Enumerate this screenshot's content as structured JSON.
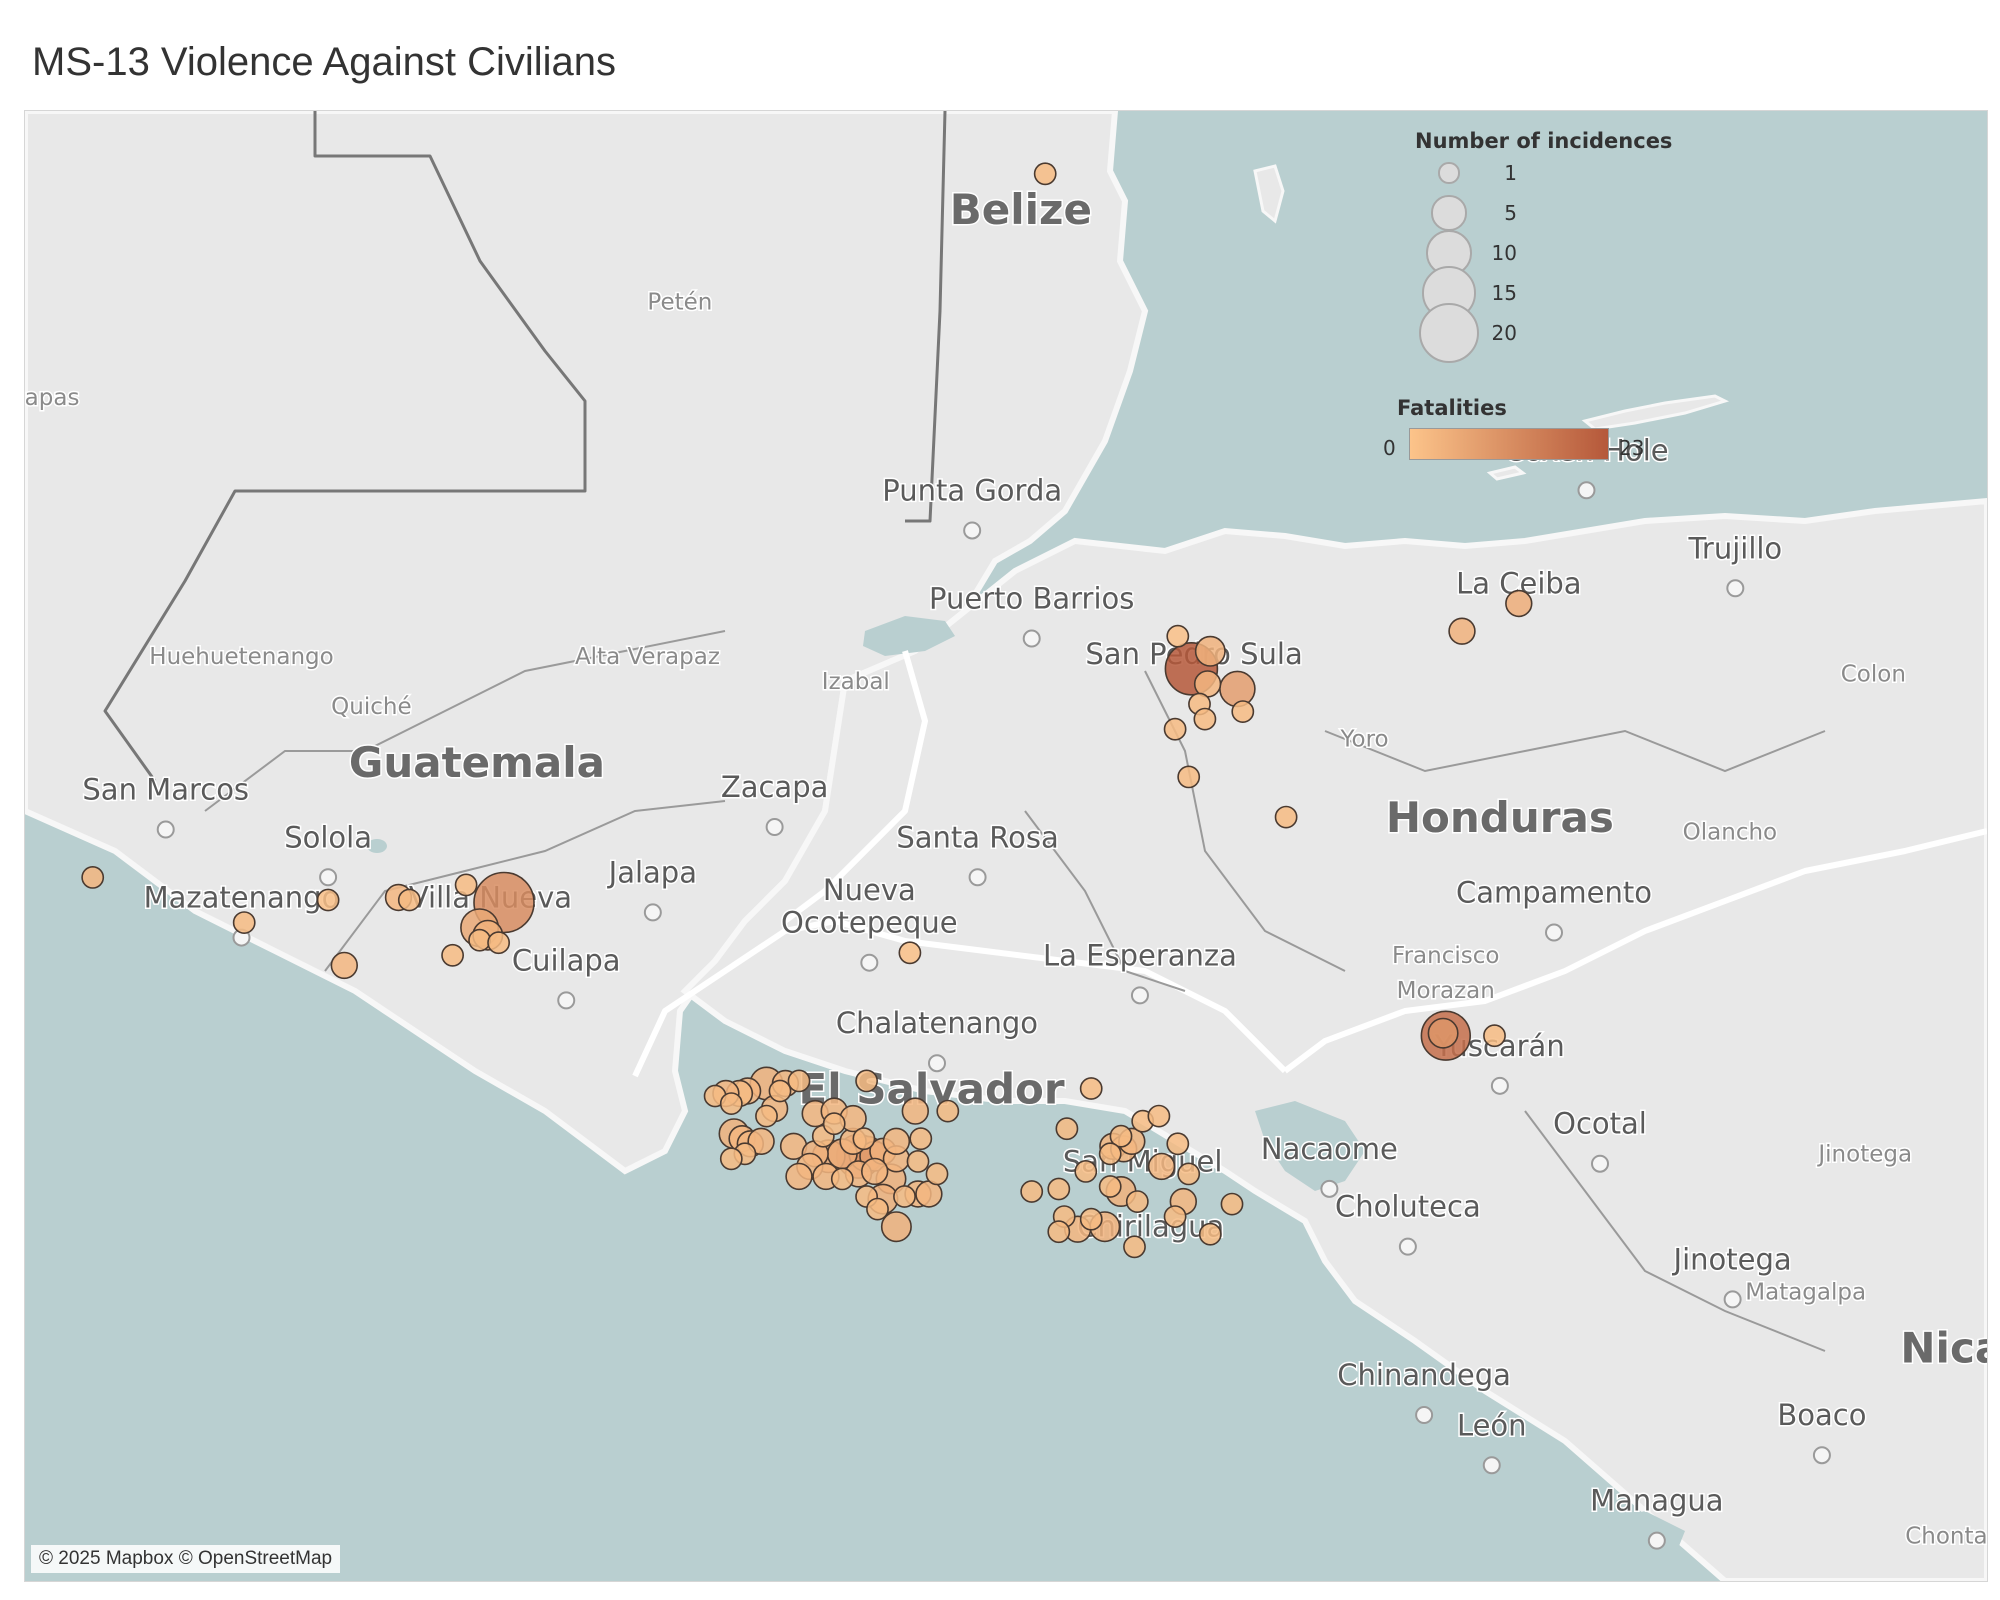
{
  "title": "MS-13 Violence Against Civilians",
  "attribution": "© 2025 Mapbox © OpenStreetMap",
  "colors": {
    "water": "#b9cfd0",
    "land": "#e8e8e8",
    "border": "#ffffff",
    "fatalities_min": "#fcc48a",
    "fatalities_max": "#b5583a"
  },
  "legend": {
    "size_title": "Number of incidences",
    "size_items": [
      {
        "label": "1",
        "value": 1
      },
      {
        "label": "5",
        "value": 5
      },
      {
        "label": "10",
        "value": 10
      },
      {
        "label": "15",
        "value": 15
      },
      {
        "label": "20",
        "value": 20
      }
    ],
    "color_title": "Fatalities",
    "color_min": "0",
    "color_max": "23"
  },
  "map": {
    "country_labels": [
      {
        "text": "Belize",
        "lon": -88.62,
        "lat": 17.25
      },
      {
        "text": "Guatemala",
        "lon": -90.63,
        "lat": 15.05
      },
      {
        "text": "Honduras",
        "lon": -86.85,
        "lat": 14.83
      },
      {
        "text": "El Salvador",
        "lon": -88.95,
        "lat": 13.75
      },
      {
        "text": "Nica",
        "lon": -85.18,
        "lat": 12.72
      }
    ],
    "city_labels": [
      {
        "text": "Punta Gorda",
        "lon": -88.8,
        "lat": 16.15,
        "dot": true
      },
      {
        "text": "Puerto Barrios",
        "lon": -88.58,
        "lat": 15.72,
        "dot": true
      },
      {
        "text": "San Pedro Sula",
        "lon": -87.98,
        "lat": 15.5,
        "dot": false
      },
      {
        "text": "La Ceiba",
        "lon": -86.78,
        "lat": 15.78,
        "dot": false
      },
      {
        "text": "Trujillo",
        "lon": -85.98,
        "lat": 15.92,
        "dot": true
      },
      {
        "text": "Coxen Hole",
        "lon": -86.53,
        "lat": 16.31,
        "dot": true
      },
      {
        "text": "San Marcos",
        "lon": -91.78,
        "lat": 14.96,
        "dot": true
      },
      {
        "text": "Solola",
        "lon": -91.18,
        "lat": 14.77,
        "dot": true
      },
      {
        "text": "Mazatenango",
        "lon": -91.5,
        "lat": 14.53,
        "dot": true
      },
      {
        "text": "Villa Nueva",
        "lon": -90.58,
        "lat": 14.53,
        "dot": false
      },
      {
        "text": "Cuilapa",
        "lon": -90.3,
        "lat": 14.28,
        "dot": true
      },
      {
        "text": "Jalapa",
        "lon": -89.98,
        "lat": 14.63,
        "dot": true
      },
      {
        "text": "Zacapa",
        "lon": -89.53,
        "lat": 14.97,
        "dot": true
      },
      {
        "text": "Santa Rosa",
        "lon": -88.78,
        "lat": 14.77,
        "dot": true
      },
      {
        "text": "Nueva",
        "lon": -89.18,
        "lat": 14.56,
        "dot": false
      },
      {
        "text": "Ocotepeque",
        "lon": -89.18,
        "lat": 14.43,
        "dot": true
      },
      {
        "text": "La Esperanza",
        "lon": -88.18,
        "lat": 14.3,
        "dot": true
      },
      {
        "text": "Chalatenango",
        "lon": -88.93,
        "lat": 14.03,
        "dot": true
      },
      {
        "text": "San Miguel",
        "lon": -88.17,
        "lat": 13.48,
        "dot": false
      },
      {
        "text": "Chirilagua",
        "lon": -88.14,
        "lat": 13.22,
        "dot": false
      },
      {
        "text": "Nacaome",
        "lon": -87.48,
        "lat": 13.53,
        "dot": true
      },
      {
        "text": "Choluteca",
        "lon": -87.19,
        "lat": 13.3,
        "dot": true
      },
      {
        "text": "Yuscarán",
        "lon": -86.85,
        "lat": 13.94,
        "dot": true
      },
      {
        "text": "Ocotal",
        "lon": -86.48,
        "lat": 13.63,
        "dot": true
      },
      {
        "text": "Jinotega",
        "lon": -85.99,
        "lat": 13.09,
        "dot": true
      },
      {
        "text": "Chinandega",
        "lon": -87.13,
        "lat": 12.63,
        "dot": true
      },
      {
        "text": "León",
        "lon": -86.88,
        "lat": 12.43,
        "dot": true
      },
      {
        "text": "Boaco",
        "lon": -85.66,
        "lat": 12.47,
        "dot": true
      },
      {
        "text": "Managua",
        "lon": -86.27,
        "lat": 12.13,
        "dot": true
      },
      {
        "text": "Campamento",
        "lon": -86.65,
        "lat": 14.55,
        "dot": true
      }
    ],
    "region_labels": [
      {
        "text": "Petén",
        "lon": -89.88,
        "lat": 16.91
      },
      {
        "text": "apas",
        "lon": -92.2,
        "lat": 16.53
      },
      {
        "text": "Huehuetenango",
        "lon": -91.5,
        "lat": 15.5
      },
      {
        "text": "Quiché",
        "lon": -91.02,
        "lat": 15.3
      },
      {
        "text": "Alta Verapaz",
        "lon": -90.0,
        "lat": 15.5
      },
      {
        "text": "Izabal",
        "lon": -89.23,
        "lat": 15.4
      },
      {
        "text": "Yoro",
        "lon": -87.35,
        "lat": 15.17
      },
      {
        "text": "Colon",
        "lon": -85.47,
        "lat": 15.43
      },
      {
        "text": "Olancho",
        "lon": -86.0,
        "lat": 14.8
      },
      {
        "text": "Francisco",
        "lon": -87.05,
        "lat": 14.31
      },
      {
        "text": "Morazan",
        "lon": -87.05,
        "lat": 14.17
      },
      {
        "text": "Jinotega",
        "lon": -85.5,
        "lat": 13.52
      },
      {
        "text": "Matagalpa",
        "lon": -85.72,
        "lat": 12.97
      },
      {
        "text": "Chonta",
        "lon": -85.2,
        "lat": 12.0
      }
    ]
  },
  "chart_data": {
    "type": "scatter",
    "title": "MS-13 Violence Against Civilians",
    "size_field": "Number of incidences",
    "color_field": "Fatalities",
    "color_range": [
      0,
      23
    ],
    "size_range": [
      1,
      20
    ],
    "points": [
      {
        "lon": -88.53,
        "lat": 17.45,
        "incidences": 1,
        "fatalities": 2
      },
      {
        "lon": -92.05,
        "lat": 14.65,
        "incidences": 1,
        "fatalities": 3
      },
      {
        "lon": -90.53,
        "lat": 14.55,
        "incidences": 20,
        "fatalities": 12
      },
      {
        "lon": -90.62,
        "lat": 14.45,
        "incidences": 6,
        "fatalities": 6
      },
      {
        "lon": -90.59,
        "lat": 14.42,
        "incidences": 3,
        "fatalities": 4
      },
      {
        "lon": -90.67,
        "lat": 14.62,
        "incidences": 1,
        "fatalities": 2
      },
      {
        "lon": -90.92,
        "lat": 14.57,
        "incidences": 2,
        "fatalities": 3
      },
      {
        "lon": -90.88,
        "lat": 14.56,
        "incidences": 1,
        "fatalities": 2
      },
      {
        "lon": -90.62,
        "lat": 14.4,
        "incidences": 1,
        "fatalities": 2
      },
      {
        "lon": -90.55,
        "lat": 14.39,
        "incidences": 1,
        "fatalities": 2
      },
      {
        "lon": -90.72,
        "lat": 14.34,
        "incidences": 1,
        "fatalities": 2
      },
      {
        "lon": -91.12,
        "lat": 14.3,
        "incidences": 2,
        "fatalities": 3
      },
      {
        "lon": -91.49,
        "lat": 14.47,
        "incidences": 1,
        "fatalities": 2
      },
      {
        "lon": -91.18,
        "lat": 14.56,
        "incidences": 1,
        "fatalities": 1
      },
      {
        "lon": -89.03,
        "lat": 14.35,
        "incidences": 1,
        "fatalities": 1
      },
      {
        "lon": -87.99,
        "lat": 15.48,
        "incidences": 14,
        "fatalities": 23
      },
      {
        "lon": -87.92,
        "lat": 15.55,
        "incidences": 3,
        "fatalities": 4
      },
      {
        "lon": -87.82,
        "lat": 15.4,
        "incidences": 5,
        "fatalities": 8
      },
      {
        "lon": -87.93,
        "lat": 15.42,
        "incidences": 2,
        "fatalities": 3
      },
      {
        "lon": -87.96,
        "lat": 15.34,
        "incidences": 1,
        "fatalities": 2
      },
      {
        "lon": -87.8,
        "lat": 15.31,
        "incidences": 1,
        "fatalities": 2
      },
      {
        "lon": -87.94,
        "lat": 15.28,
        "incidences": 1,
        "fatalities": 2
      },
      {
        "lon": -88.04,
        "lat": 15.61,
        "incidences": 1,
        "fatalities": 1
      },
      {
        "lon": -88.05,
        "lat": 15.24,
        "incidences": 1,
        "fatalities": 2
      },
      {
        "lon": -88.0,
        "lat": 15.05,
        "incidences": 1,
        "fatalities": 2
      },
      {
        "lon": -87.64,
        "lat": 14.89,
        "incidences": 1,
        "fatalities": 2
      },
      {
        "lon": -86.78,
        "lat": 15.74,
        "incidences": 2,
        "fatalities": 5
      },
      {
        "lon": -86.99,
        "lat": 15.63,
        "incidences": 2,
        "fatalities": 4
      },
      {
        "lon": -87.05,
        "lat": 14.02,
        "incidences": 12,
        "fatalities": 18
      },
      {
        "lon": -87.06,
        "lat": 14.03,
        "incidences": 3,
        "fatalities": 10
      },
      {
        "lon": -86.87,
        "lat": 14.02,
        "incidences": 1,
        "fatalities": 2
      },
      {
        "lon": -89.56,
        "lat": 13.83,
        "incidences": 4,
        "fatalities": 4
      },
      {
        "lon": -89.49,
        "lat": 13.83,
        "incidences": 2,
        "fatalities": 3
      },
      {
        "lon": -89.51,
        "lat": 13.8,
        "incidences": 1,
        "fatalities": 2
      },
      {
        "lon": -89.44,
        "lat": 13.84,
        "incidences": 1,
        "fatalities": 2
      },
      {
        "lon": -89.63,
        "lat": 13.8,
        "incidences": 2,
        "fatalities": 3
      },
      {
        "lon": -89.66,
        "lat": 13.79,
        "incidences": 2,
        "fatalities": 2
      },
      {
        "lon": -89.71,
        "lat": 13.79,
        "incidences": 2,
        "fatalities": 3
      },
      {
        "lon": -89.75,
        "lat": 13.78,
        "incidences": 1,
        "fatalities": 2
      },
      {
        "lon": -89.69,
        "lat": 13.75,
        "incidences": 1,
        "fatalities": 2
      },
      {
        "lon": -89.53,
        "lat": 13.73,
        "incidences": 2,
        "fatalities": 3
      },
      {
        "lon": -89.56,
        "lat": 13.7,
        "incidences": 1,
        "fatalities": 2
      },
      {
        "lon": -89.68,
        "lat": 13.63,
        "incidences": 3,
        "fatalities": 4
      },
      {
        "lon": -89.65,
        "lat": 13.61,
        "incidences": 2,
        "fatalities": 3
      },
      {
        "lon": -89.62,
        "lat": 13.59,
        "incidences": 2,
        "fatalities": 3
      },
      {
        "lon": -89.58,
        "lat": 13.6,
        "incidences": 2,
        "fatalities": 3
      },
      {
        "lon": -89.64,
        "lat": 13.55,
        "incidences": 1,
        "fatalities": 2
      },
      {
        "lon": -89.69,
        "lat": 13.53,
        "incidences": 1,
        "fatalities": 2
      },
      {
        "lon": -89.46,
        "lat": 13.58,
        "incidences": 2,
        "fatalities": 3
      },
      {
        "lon": -89.38,
        "lat": 13.55,
        "incidences": 2,
        "fatalities": 4
      },
      {
        "lon": -89.33,
        "lat": 13.54,
        "incidences": 4,
        "fatalities": 6
      },
      {
        "lon": -89.28,
        "lat": 13.55,
        "incidences": 3,
        "fatalities": 5
      },
      {
        "lon": -89.22,
        "lat": 13.54,
        "incidences": 9,
        "fatalities": 14
      },
      {
        "lon": -89.19,
        "lat": 13.55,
        "incidences": 5,
        "fatalities": 10
      },
      {
        "lon": -89.16,
        "lat": 13.54,
        "incidences": 3,
        "fatalities": 8
      },
      {
        "lon": -89.13,
        "lat": 13.56,
        "incidences": 2,
        "fatalities": 4
      },
      {
        "lon": -89.08,
        "lat": 13.53,
        "incidences": 2,
        "fatalities": 3
      },
      {
        "lon": -89.24,
        "lat": 13.6,
        "incidences": 2,
        "fatalities": 3
      },
      {
        "lon": -89.2,
        "lat": 13.61,
        "incidences": 1,
        "fatalities": 2
      },
      {
        "lon": -89.35,
        "lat": 13.62,
        "incidences": 1,
        "fatalities": 2
      },
      {
        "lon": -89.4,
        "lat": 13.5,
        "incidences": 2,
        "fatalities": 3
      },
      {
        "lon": -89.44,
        "lat": 13.46,
        "incidences": 2,
        "fatalities": 3
      },
      {
        "lon": -89.34,
        "lat": 13.46,
        "incidences": 2,
        "fatalities": 3
      },
      {
        "lon": -89.28,
        "lat": 13.45,
        "incidences": 1,
        "fatalities": 2
      },
      {
        "lon": -89.22,
        "lat": 13.47,
        "incidences": 2,
        "fatalities": 3
      },
      {
        "lon": -89.16,
        "lat": 13.48,
        "incidences": 2,
        "fatalities": 3
      },
      {
        "lon": -89.1,
        "lat": 13.45,
        "incidences": 3,
        "fatalities": 4
      },
      {
        "lon": -89.05,
        "lat": 13.38,
        "incidences": 1,
        "fatalities": 2
      },
      {
        "lon": -89.0,
        "lat": 13.39,
        "incidences": 2,
        "fatalities": 3
      },
      {
        "lon": -89.13,
        "lat": 13.37,
        "incidences": 3,
        "fatalities": 4
      },
      {
        "lon": -89.19,
        "lat": 13.38,
        "incidences": 1,
        "fatalities": 2
      },
      {
        "lon": -89.0,
        "lat": 13.52,
        "incidences": 1,
        "fatalities": 2
      },
      {
        "lon": -88.93,
        "lat": 13.47,
        "incidences": 1,
        "fatalities": 2
      },
      {
        "lon": -88.96,
        "lat": 13.39,
        "incidences": 2,
        "fatalities": 3
      },
      {
        "lon": -88.99,
        "lat": 13.61,
        "incidences": 1,
        "fatalities": 2
      },
      {
        "lon": -89.08,
        "lat": 13.6,
        "incidences": 2,
        "fatalities": 3
      },
      {
        "lon": -89.38,
        "lat": 13.71,
        "incidences": 2,
        "fatalities": 3
      },
      {
        "lon": -89.31,
        "lat": 13.72,
        "incidences": 2,
        "fatalities": 3
      },
      {
        "lon": -89.24,
        "lat": 13.69,
        "incidences": 2,
        "fatalities": 3
      },
      {
        "lon": -89.31,
        "lat": 13.67,
        "incidences": 1,
        "fatalities": 2
      },
      {
        "lon": -89.19,
        "lat": 13.84,
        "incidences": 1,
        "fatalities": 2
      },
      {
        "lon": -89.01,
        "lat": 13.72,
        "incidences": 2,
        "fatalities": 3
      },
      {
        "lon": -88.89,
        "lat": 13.72,
        "incidences": 1,
        "fatalities": 2
      },
      {
        "lon": -89.08,
        "lat": 13.26,
        "incidences": 3,
        "fatalities": 4
      },
      {
        "lon": -89.15,
        "lat": 13.33,
        "incidences": 1,
        "fatalities": 2
      },
      {
        "lon": -88.36,
        "lat": 13.81,
        "incidences": 1,
        "fatalities": 2
      },
      {
        "lon": -88.45,
        "lat": 13.65,
        "incidences": 1,
        "fatalities": 2
      },
      {
        "lon": -88.28,
        "lat": 13.58,
        "incidences": 2,
        "fatalities": 3
      },
      {
        "lon": -88.24,
        "lat": 13.57,
        "incidences": 2,
        "fatalities": 3
      },
      {
        "lon": -88.21,
        "lat": 13.6,
        "incidences": 2,
        "fatalities": 3
      },
      {
        "lon": -88.25,
        "lat": 13.62,
        "incidences": 1,
        "fatalities": 2
      },
      {
        "lon": -88.29,
        "lat": 13.55,
        "incidences": 1,
        "fatalities": 2
      },
      {
        "lon": -88.17,
        "lat": 13.68,
        "incidences": 1,
        "fatalities": 2
      },
      {
        "lon": -88.11,
        "lat": 13.7,
        "incidences": 1,
        "fatalities": 2
      },
      {
        "lon": -88.04,
        "lat": 13.59,
        "incidences": 1,
        "fatalities": 2
      },
      {
        "lon": -88.1,
        "lat": 13.5,
        "incidences": 2,
        "fatalities": 3
      },
      {
        "lon": -88.25,
        "lat": 13.4,
        "incidences": 3,
        "fatalities": 4
      },
      {
        "lon": -88.29,
        "lat": 13.42,
        "incidences": 1,
        "fatalities": 2
      },
      {
        "lon": -88.19,
        "lat": 13.36,
        "incidences": 1,
        "fatalities": 2
      },
      {
        "lon": -88.38,
        "lat": 13.48,
        "incidences": 1,
        "fatalities": 2
      },
      {
        "lon": -88.48,
        "lat": 13.41,
        "incidences": 1,
        "fatalities": 2
      },
      {
        "lon": -88.58,
        "lat": 13.4,
        "incidences": 1,
        "fatalities": 2
      },
      {
        "lon": -88.31,
        "lat": 13.26,
        "incidences": 3,
        "fatalities": 4
      },
      {
        "lon": -88.36,
        "lat": 13.29,
        "incidences": 1,
        "fatalities": 2
      },
      {
        "lon": -88.41,
        "lat": 13.25,
        "incidences": 2,
        "fatalities": 3
      },
      {
        "lon": -88.46,
        "lat": 13.3,
        "incidences": 1,
        "fatalities": 2
      },
      {
        "lon": -88.48,
        "lat": 13.24,
        "incidences": 1,
        "fatalities": 2
      },
      {
        "lon": -88.2,
        "lat": 13.18,
        "incidences": 1,
        "fatalities": 2
      },
      {
        "lon": -88.05,
        "lat": 13.3,
        "incidences": 1,
        "fatalities": 2
      },
      {
        "lon": -88.02,
        "lat": 13.36,
        "incidences": 2,
        "fatalities": 3
      },
      {
        "lon": -88.0,
        "lat": 13.47,
        "incidences": 1,
        "fatalities": 2
      },
      {
        "lon": -87.92,
        "lat": 13.23,
        "incidences": 1,
        "fatalities": 2
      },
      {
        "lon": -87.84,
        "lat": 13.35,
        "incidences": 1,
        "fatalities": 2
      }
    ]
  }
}
